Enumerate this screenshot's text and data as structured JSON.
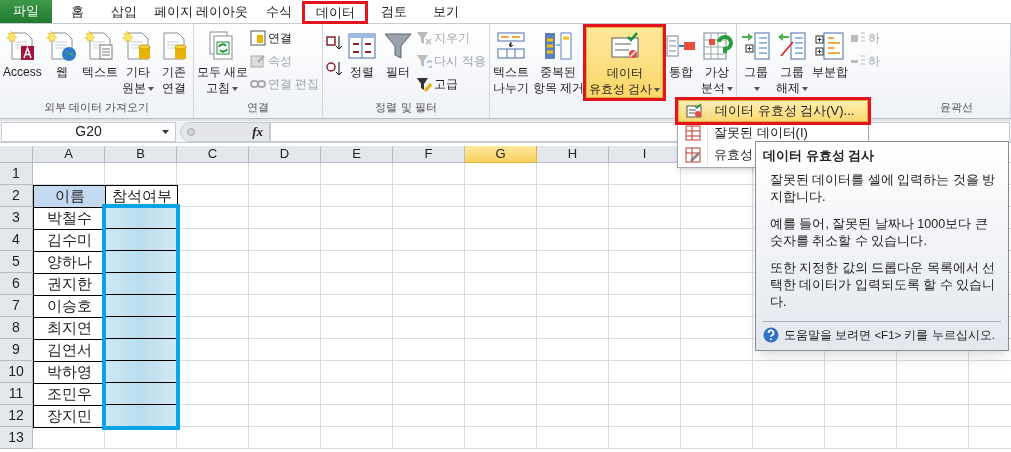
{
  "tabs": [
    {
      "label": "파일",
      "kind": "file",
      "selected": false,
      "annotated": false
    },
    {
      "label": "홈",
      "kind": "tab",
      "selected": false,
      "annotated": false
    },
    {
      "label": "삽입",
      "kind": "tab",
      "selected": false,
      "annotated": false
    },
    {
      "label": "페이지 레이아웃",
      "kind": "tab",
      "selected": false,
      "annotated": false
    },
    {
      "label": "수식",
      "kind": "tab",
      "selected": false,
      "annotated": false
    },
    {
      "label": "데이터",
      "kind": "tab",
      "selected": true,
      "annotated": true
    },
    {
      "label": "검토",
      "kind": "tab",
      "selected": false,
      "annotated": false
    },
    {
      "label": "보기",
      "kind": "tab",
      "selected": false,
      "annotated": false
    }
  ],
  "ribbon": {
    "groups": [
      {
        "label": "외부 데이터 가져오기",
        "items": [
          {
            "kind": "large",
            "lines": [
              "Access"
            ],
            "dropdown": false
          },
          {
            "kind": "large",
            "lines": [
              "웹"
            ],
            "dropdown": false
          },
          {
            "kind": "large",
            "lines": [
              "텍스트"
            ],
            "dropdown": false
          },
          {
            "kind": "large",
            "lines": [
              "기타",
              "원본"
            ],
            "dropdown": true
          },
          {
            "kind": "large",
            "lines": [
              "기존",
              "연결"
            ],
            "dropdown": false
          }
        ]
      },
      {
        "label": "연결",
        "items": [
          {
            "kind": "large",
            "lines": [
              "모두 새로",
              "고침"
            ],
            "dropdown": true
          },
          {
            "kind": "stack",
            "buttons": [
              {
                "label": "연결",
                "disabled": false
              },
              {
                "label": "속성",
                "disabled": true
              },
              {
                "label": "연결 편집",
                "disabled": true
              }
            ]
          }
        ]
      },
      {
        "label": "정렬 및 필터",
        "items": [
          {
            "kind": "sort_pair"
          },
          {
            "kind": "large",
            "lines": [
              "정렬"
            ],
            "dropdown": false
          },
          {
            "kind": "large",
            "lines": [
              "필터"
            ],
            "dropdown": false
          },
          {
            "kind": "stack",
            "buttons": [
              {
                "label": "지우기",
                "disabled": true
              },
              {
                "label": "다시 적용",
                "disabled": true
              },
              {
                "label": "고급",
                "disabled": false
              }
            ]
          }
        ]
      },
      {
        "items": [
          {
            "kind": "large",
            "lines": [
              "텍스트",
              "나누기"
            ],
            "dropdown": false
          },
          {
            "kind": "large",
            "lines": [
              "중복된",
              "항목 제거"
            ],
            "dropdown": false
          },
          {
            "kind": "large",
            "lines": [
              "데이터",
              "유효성 검사"
            ],
            "dropdown": true,
            "selected": true,
            "annotated": true
          },
          {
            "kind": "large",
            "lines": [
              "통합"
            ],
            "dropdown": false
          },
          {
            "kind": "large",
            "lines": [
              "가상",
              "분석"
            ],
            "dropdown": true
          }
        ]
      },
      {
        "label": "윤곽선",
        "items": [
          {
            "kind": "large",
            "lines": [
              "그룹"
            ],
            "dropdown": true
          },
          {
            "kind": "large",
            "lines": [
              "그룹",
              "해제"
            ],
            "dropdown": true
          },
          {
            "kind": "large",
            "lines": [
              "부분합"
            ],
            "dropdown": false
          },
          {
            "kind": "stack",
            "buttons": [
              {
                "label": "하",
                "disabled": true
              },
              {
                "label": "하",
                "disabled": true
              }
            ]
          }
        ]
      }
    ]
  },
  "menu": {
    "items": [
      {
        "label": "데이터 유효성 검사(V)...",
        "selected": true,
        "annotated": true
      },
      {
        "label": "잘못된 데이터(I)",
        "selected": false,
        "annotated": false
      },
      {
        "label": "유효성",
        "selected": false,
        "annotated": false
      }
    ]
  },
  "tooltip": {
    "title": "데이터 유효성 검사",
    "paragraphs": [
      "잘못된 데이터를 셀에 입력하는 것을 방지합니다.",
      "예를 들어, 잘못된 날짜나 1000보다 큰 숫자를 취소할 수 있습니다.",
      "또한 지정한 값의 드롭다운 목록에서 선택한 데이터가 입력되도록 할 수 있습니다."
    ],
    "help": "도움말을 보려면 <F1> 키를 누르십시오."
  },
  "formula_bar": {
    "name_box": "G20",
    "function_label": "fx"
  },
  "sheet": {
    "columns": [
      {
        "label": "A",
        "selected": false
      },
      {
        "label": "B",
        "selected": false
      },
      {
        "label": "C",
        "selected": false
      },
      {
        "label": "D",
        "selected": false
      },
      {
        "label": "E",
        "selected": false
      },
      {
        "label": "F",
        "selected": false
      },
      {
        "label": "G",
        "selected": true
      },
      {
        "label": "H",
        "selected": false
      },
      {
        "label": "I",
        "selected": false
      }
    ],
    "rows": [
      {
        "number": "1",
        "kind": "empty"
      },
      {
        "number": "2",
        "kind": "heading",
        "cells": [
          "이름",
          "참석여부"
        ]
      },
      {
        "number": "3",
        "kind": "entry",
        "cells": [
          "박철수"
        ]
      },
      {
        "number": "4",
        "kind": "entry",
        "cells": [
          "김수미"
        ]
      },
      {
        "number": "5",
        "kind": "entry",
        "cells": [
          "양하나"
        ]
      },
      {
        "number": "6",
        "kind": "entry",
        "cells": [
          "권지한"
        ]
      },
      {
        "number": "7",
        "kind": "entry",
        "cells": [
          "이승호"
        ]
      },
      {
        "number": "8",
        "kind": "entry",
        "cells": [
          "최지연"
        ]
      },
      {
        "number": "9",
        "kind": "entry",
        "cells": [
          "김연서"
        ]
      },
      {
        "number": "10",
        "kind": "entry",
        "cells": [
          "박하영"
        ]
      },
      {
        "number": "11",
        "kind": "entry",
        "cells": [
          "조민우"
        ]
      },
      {
        "number": "12",
        "kind": "entry",
        "cells": [
          "장지민"
        ]
      },
      {
        "number": "13",
        "kind": "empty"
      }
    ]
  }
}
